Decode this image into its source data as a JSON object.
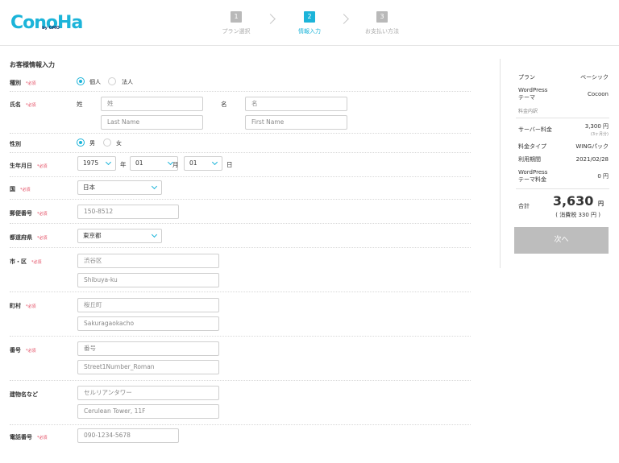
{
  "header": {
    "logo": "ConoHa",
    "logo_sub": "by GMO",
    "steps": [
      {
        "num": "1",
        "label": "プラン選択"
      },
      {
        "num": "2",
        "label": "情報入力"
      },
      {
        "num": "3",
        "label": "お支払い方法"
      }
    ]
  },
  "form": {
    "title": "お客様情報入力",
    "required": "*必須",
    "type": {
      "label": "種別",
      "opt1": "個人",
      "opt2": "法人"
    },
    "name": {
      "label": "氏名",
      "sei": "姓",
      "mei": "名",
      "sei_placeholder": "姓",
      "mei_placeholder": "名",
      "last_placeholder": "Last Name",
      "first_placeholder": "First Name"
    },
    "gender": {
      "label": "性別",
      "opt1": "男",
      "opt2": "女"
    },
    "birthday": {
      "label": "生年月日",
      "year": "1975",
      "year_unit": "年",
      "month": "01",
      "month_unit": "月",
      "day": "01",
      "day_unit": "日"
    },
    "country": {
      "label": "国",
      "value": "日本"
    },
    "postal": {
      "label": "郵便番号",
      "placeholder": "150-8512"
    },
    "prefecture": {
      "label": "都道府県",
      "value": "東京都"
    },
    "city": {
      "label": "市・区",
      "placeholder_jp": "渋谷区",
      "placeholder_en": "Shibuya-ku"
    },
    "town": {
      "label": "町村",
      "placeholder_jp": "桜丘町",
      "placeholder_en": "Sakuragaokacho"
    },
    "street": {
      "label": "番号",
      "placeholder_jp": "番号",
      "placeholder_en": "Street1Number_Roman"
    },
    "building": {
      "label": "建物名など",
      "placeholder_jp": "セルリアンタワー",
      "placeholder_en": "Cerulean Tower, 11F"
    },
    "phone": {
      "label": "電話番号",
      "placeholder": "090-1234-5678"
    }
  },
  "summary": {
    "plan_key": "プラン",
    "plan_val": "ベーシック",
    "theme_key": "WordPress\nテーマ",
    "theme_val": "Cocoon",
    "detail_label": "料金内訳",
    "server_key": "サーバー料金",
    "server_val": "3,300 円",
    "server_sub": "(3ヶ月分)",
    "type_key": "料金タイプ",
    "type_val": "WINGパック",
    "period_key": "利用期間",
    "period_val": "2021/02/28",
    "theme_fee_key": "WordPress\nテーマ料金",
    "theme_fee_val": "0 円",
    "total_key": "合計",
    "total_val": "3,630",
    "total_unit": "円",
    "tax": "( 消費税 330 円 )",
    "next_button": "次へ"
  },
  "colors": {
    "accent": "#1cb4d9",
    "required": "#e2455c",
    "button_disabled": "#bdbdbd"
  }
}
